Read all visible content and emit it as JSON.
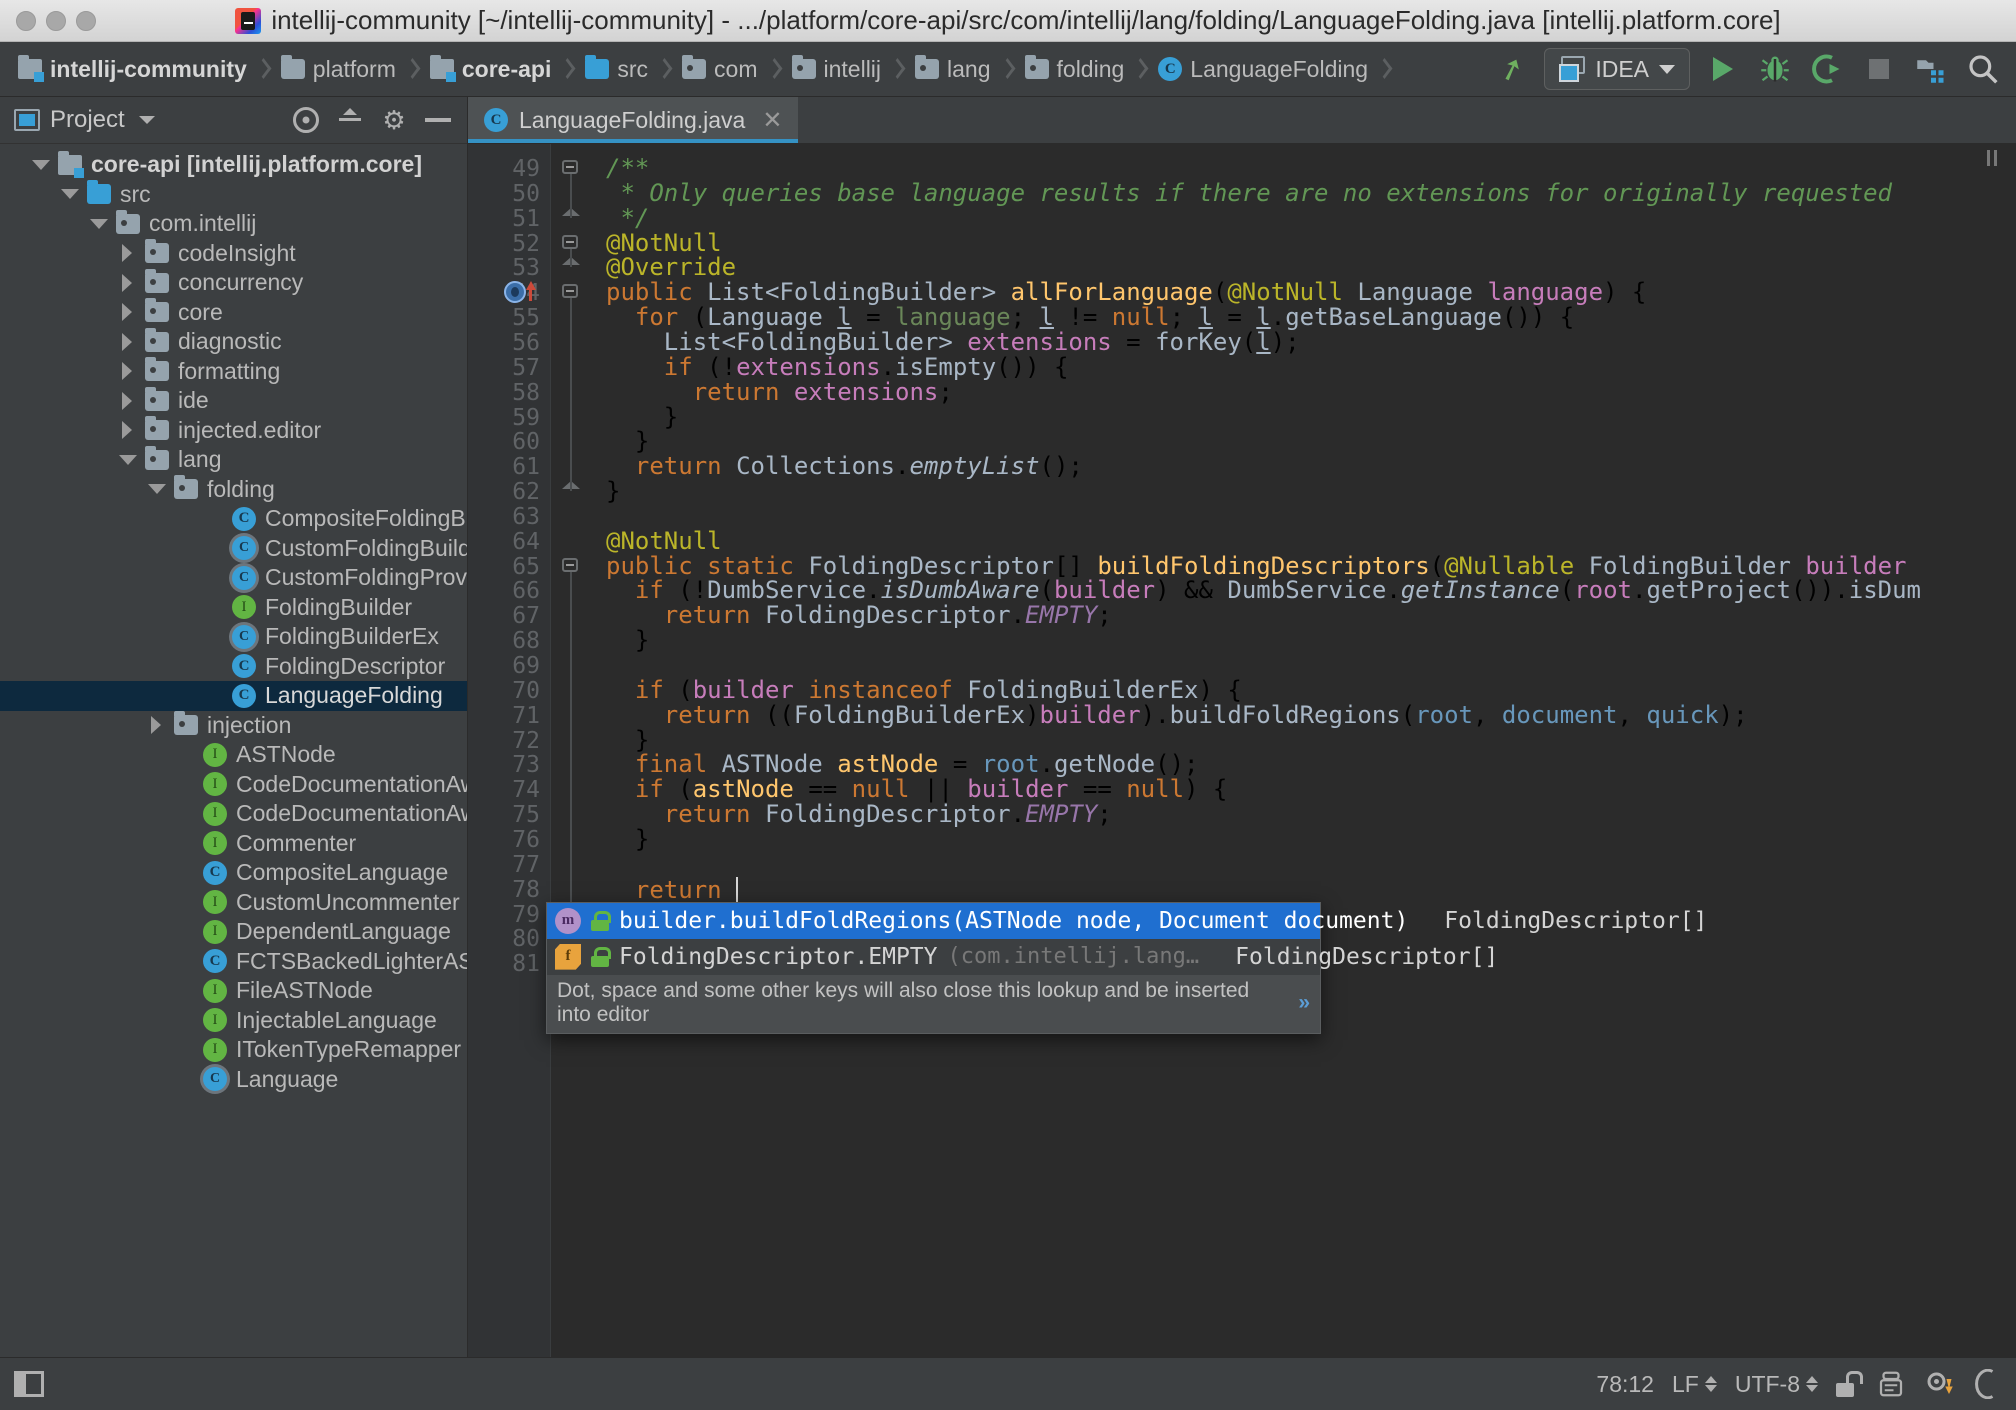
{
  "window": {
    "title": "intellij-community [~/intellij-community] - .../platform/core-api/src/com/intellij/lang/folding/LanguageFolding.java [intellij.platform.core]",
    "logo_icon": "intellij-idea-logo",
    "traffic_lights": [
      "close-button",
      "minimize-button",
      "zoom-button"
    ]
  },
  "navbar": {
    "breadcrumbs": [
      {
        "label": "intellij-community",
        "icon": "module-icon",
        "bold": true
      },
      {
        "label": "platform",
        "icon": "folder-icon",
        "bold": false
      },
      {
        "label": "core-api",
        "icon": "module-icon",
        "bold": true
      },
      {
        "label": "src",
        "icon": "source-folder-icon",
        "bold": false
      },
      {
        "label": "com",
        "icon": "package-icon",
        "bold": false
      },
      {
        "label": "intellij",
        "icon": "package-icon",
        "bold": false
      },
      {
        "label": "lang",
        "icon": "package-icon",
        "bold": false
      },
      {
        "label": "folding",
        "icon": "package-icon",
        "bold": false
      },
      {
        "label": "LanguageFolding",
        "icon": "class-icon",
        "bold": false
      }
    ],
    "actions": {
      "build_label": "Build",
      "run_config_label": "IDEA",
      "run_label": "Run",
      "debug_label": "Debug",
      "run_coverage_label": "Run with Coverage",
      "stop_label": "Stop",
      "project_structure_label": "Project Structure",
      "search_label": "Search Everywhere"
    }
  },
  "sidebar": {
    "title": "Project",
    "toolbar": [
      "locate-icon",
      "collapse-all-icon",
      "settings-icon",
      "hide-icon"
    ],
    "tree": [
      {
        "label": "core-api [intellij.platform.core]",
        "indent": 0,
        "arrow": "open",
        "icon": "module-icon",
        "bold": true,
        "selected": false
      },
      {
        "label": "src",
        "indent": 1,
        "arrow": "open",
        "icon": "source-folder-icon",
        "bold": false,
        "selected": false
      },
      {
        "label": "com.intellij",
        "indent": 2,
        "arrow": "open",
        "icon": "package-icon",
        "bold": false,
        "selected": false
      },
      {
        "label": "codeInsight",
        "indent": 3,
        "arrow": "closed",
        "icon": "package-icon",
        "bold": false,
        "selected": false
      },
      {
        "label": "concurrency",
        "indent": 3,
        "arrow": "closed",
        "icon": "package-icon",
        "bold": false,
        "selected": false
      },
      {
        "label": "core",
        "indent": 3,
        "arrow": "closed",
        "icon": "package-icon",
        "bold": false,
        "selected": false
      },
      {
        "label": "diagnostic",
        "indent": 3,
        "arrow": "closed",
        "icon": "package-icon",
        "bold": false,
        "selected": false
      },
      {
        "label": "formatting",
        "indent": 3,
        "arrow": "closed",
        "icon": "package-icon",
        "bold": false,
        "selected": false
      },
      {
        "label": "ide",
        "indent": 3,
        "arrow": "closed",
        "icon": "package-icon",
        "bold": false,
        "selected": false
      },
      {
        "label": "injected.editor",
        "indent": 3,
        "arrow": "closed",
        "icon": "package-icon",
        "bold": false,
        "selected": false
      },
      {
        "label": "lang",
        "indent": 3,
        "arrow": "open",
        "icon": "package-icon",
        "bold": false,
        "selected": false
      },
      {
        "label": "folding",
        "indent": 4,
        "arrow": "open",
        "icon": "package-icon",
        "bold": false,
        "selected": false
      },
      {
        "label": "CompositeFoldingBuilder",
        "indent": 6,
        "arrow": "none",
        "icon": "class-icon",
        "bold": false,
        "selected": false
      },
      {
        "label": "CustomFoldingBuilder",
        "indent": 6,
        "arrow": "none",
        "icon": "abstract-class-icon",
        "bold": false,
        "selected": false
      },
      {
        "label": "CustomFoldingProvider",
        "indent": 6,
        "arrow": "none",
        "icon": "abstract-class-icon",
        "bold": false,
        "selected": false
      },
      {
        "label": "FoldingBuilder",
        "indent": 6,
        "arrow": "none",
        "icon": "interface-icon",
        "bold": false,
        "selected": false
      },
      {
        "label": "FoldingBuilderEx",
        "indent": 6,
        "arrow": "none",
        "icon": "abstract-class-icon",
        "bold": false,
        "selected": false
      },
      {
        "label": "FoldingDescriptor",
        "indent": 6,
        "arrow": "none",
        "icon": "class-icon",
        "bold": false,
        "selected": false
      },
      {
        "label": "LanguageFolding",
        "indent": 6,
        "arrow": "none",
        "icon": "class-icon",
        "bold": false,
        "selected": true
      },
      {
        "label": "injection",
        "indent": 4,
        "arrow": "closed",
        "icon": "package-icon",
        "bold": false,
        "selected": false
      },
      {
        "label": "ASTNode",
        "indent": 5,
        "arrow": "none",
        "icon": "interface-icon",
        "bold": false,
        "selected": false
      },
      {
        "label": "CodeDocumentationAwareCo",
        "indent": 5,
        "arrow": "none",
        "icon": "interface-icon",
        "bold": false,
        "selected": false
      },
      {
        "label": "CodeDocumentationAwareCo",
        "indent": 5,
        "arrow": "none",
        "icon": "interface-icon",
        "bold": false,
        "selected": false
      },
      {
        "label": "Commenter",
        "indent": 5,
        "arrow": "none",
        "icon": "interface-icon",
        "bold": false,
        "selected": false
      },
      {
        "label": "CompositeLanguage",
        "indent": 5,
        "arrow": "none",
        "icon": "class-icon",
        "bold": false,
        "selected": false
      },
      {
        "label": "CustomUncommenter",
        "indent": 5,
        "arrow": "none",
        "icon": "interface-icon",
        "bold": false,
        "selected": false
      },
      {
        "label": "DependentLanguage",
        "indent": 5,
        "arrow": "none",
        "icon": "interface-icon",
        "bold": false,
        "selected": false
      },
      {
        "label": "FCTSBackedLighterAST",
        "indent": 5,
        "arrow": "none",
        "icon": "class-icon",
        "bold": false,
        "selected": false
      },
      {
        "label": "FileASTNode",
        "indent": 5,
        "arrow": "none",
        "icon": "interface-icon",
        "bold": false,
        "selected": false
      },
      {
        "label": "InjectableLanguage",
        "indent": 5,
        "arrow": "none",
        "icon": "interface-icon",
        "bold": false,
        "selected": false
      },
      {
        "label": "ITokenTypeRemapper",
        "indent": 5,
        "arrow": "none",
        "icon": "interface-icon",
        "bold": false,
        "selected": false
      },
      {
        "label": "Language",
        "indent": 5,
        "arrow": "none",
        "icon": "abstract-class-icon",
        "bold": false,
        "selected": false
      }
    ]
  },
  "editor": {
    "tab": {
      "label": "LanguageFolding.java",
      "icon": "class-icon",
      "close_icon": "close-icon"
    },
    "first_line_number": 49,
    "lines": [
      {
        "n": 49,
        "html": "<span class=\"cmt\">/**</span>"
      },
      {
        "n": 50,
        "html": "<span class=\"cmt\"> * Only queries base language results if there are no extensions for originally requested</span>"
      },
      {
        "n": 51,
        "html": "<span class=\"cmt\"> */</span>"
      },
      {
        "n": 52,
        "html": "<span class=\"ann\">@NotNull</span>"
      },
      {
        "n": 53,
        "html": "<span class=\"ann\">@Override</span>"
      },
      {
        "n": 54,
        "html": "<span class=\"kw\">public</span> <span class=\"id\">List&lt;FoldingBuilder&gt;</span> <span class=\"mth\">allForLanguage</span>(<span class=\"ann\">@NotNull</span> <span class=\"id\">Language</span> <span class=\"par\">language</span>) {"
      },
      {
        "n": 55,
        "html": "  <span class=\"kw\">for</span> (<span class=\"id\">Language</span> <span class=\"id undl\">l</span> = <span class=\"grn\">language</span>; <span class=\"id undl\">l</span> != <span class=\"kw\">null</span>; <span class=\"id undl\">l</span> = <span class=\"id undl\">l</span>.<span class=\"id\">getBaseLanguage</span>()) {"
      },
      {
        "n": 56,
        "html": "    <span class=\"id\">List&lt;FoldingBuilder&gt;</span> <span class=\"par\">extensions</span> = <span class=\"id\">forKey</span>(<span class=\"id undl\">l</span>);"
      },
      {
        "n": 57,
        "html": "    <span class=\"kw\">if</span> (!<span class=\"par\">extensions</span>.<span class=\"id\">isEmpty</span>()) {"
      },
      {
        "n": 58,
        "html": "      <span class=\"kw\">return</span> <span class=\"par\">extensions</span>;"
      },
      {
        "n": 59,
        "html": "    }"
      },
      {
        "n": 60,
        "html": "  }"
      },
      {
        "n": 61,
        "html": "  <span class=\"kw\">return</span> <span class=\"id\">Collections</span>.<span class=\"id ital\">emptyList</span>();"
      },
      {
        "n": 62,
        "html": "}"
      },
      {
        "n": 63,
        "html": ""
      },
      {
        "n": 64,
        "html": "<span class=\"ann\">@NotNull</span>"
      },
      {
        "n": 65,
        "html": "<span class=\"kw\">public</span> <span class=\"kw\">static</span> <span class=\"id\">FoldingDescriptor</span>[] <span class=\"mth\">buildFoldingDescriptors</span>(<span class=\"ann\">@Nullable</span> <span class=\"id\">FoldingBuilder</span> <span class=\"par\">builder</span>"
      },
      {
        "n": 66,
        "html": "  <span class=\"kw\">if</span> (!<span class=\"id\">DumbService</span>.<span class=\"id ital\">isDumbAware</span>(<span class=\"par\">builder</span>) &amp;&amp; <span class=\"id\">DumbService</span>.<span class=\"id ital\">getInstance</span>(<span class=\"par\">root</span>.<span class=\"id\">getProject</span>()).<span class=\"id\">isDum</span>"
      },
      {
        "n": 67,
        "html": "    <span class=\"kw\">return</span> <span class=\"id\">FoldingDescriptor</span>.<span class=\"fld ital\">EMPTY</span>;"
      },
      {
        "n": 68,
        "html": "  }"
      },
      {
        "n": 69,
        "html": ""
      },
      {
        "n": 70,
        "html": "  <span class=\"kw\">if</span> (<span class=\"par\">builder</span> <span class=\"kw\">instanceof</span> <span class=\"id\">FoldingBuilderEx</span>) {"
      },
      {
        "n": 71,
        "html": "    <span class=\"kw\">return</span> ((<span class=\"id\">FoldingBuilderEx</span>)<span class=\"par\">builder</span>).<span class=\"id\">buildFoldRegions</span>(<span class=\"blu\">root</span>, <span class=\"blu\">document</span>, <span class=\"blu\">quick</span>);"
      },
      {
        "n": 72,
        "html": "  }"
      },
      {
        "n": 73,
        "html": "  <span class=\"kw\">final</span> <span class=\"id\">ASTNode</span> <span class=\"mth\">astNode</span> = <span class=\"blu\">root</span>.<span class=\"id\">getNode</span>();"
      },
      {
        "n": 74,
        "html": "  <span class=\"kw\">if</span> (<span class=\"mth\">astNode</span> == <span class=\"kw\">null</span> || <span class=\"par\">builder</span> == <span class=\"kw\">null</span>) {"
      },
      {
        "n": 75,
        "html": "    <span class=\"kw\">return</span> <span class=\"id\">FoldingDescriptor</span>.<span class=\"fld ital\">EMPTY</span>;"
      },
      {
        "n": 76,
        "html": "  }"
      },
      {
        "n": 77,
        "html": ""
      },
      {
        "n": 78,
        "html": "  <span class=\"kw\">return</span> <span class=\"caret\"></span>"
      },
      {
        "n": 79,
        "html": "}"
      },
      {
        "n": 80,
        "html": "}"
      },
      {
        "n": 81,
        "html": ""
      }
    ]
  },
  "lookup": {
    "items": [
      {
        "text": "builder.buildFoldRegions(ASTNode node, Document document)",
        "dim": "",
        "type": "FoldingDescriptor[]",
        "icon": "method-icon",
        "visibility_icon": "public-lock-icon",
        "selected": true
      },
      {
        "text": "FoldingDescriptor.EMPTY",
        "dim": "(com.intellij.lang…",
        "type": "FoldingDescriptor[]",
        "icon": "field-icon",
        "visibility_icon": "public-lock-icon",
        "selected": false
      }
    ],
    "hint": "Dot, space and some other keys will also close this lookup and be inserted into editor",
    "hint_arrow": "»"
  },
  "statusbar": {
    "toggle_icon": "toggle-sidebar-icon",
    "caret_position": "78:12",
    "line_separator": "LF",
    "encoding": "UTF-8",
    "lock_icon": "unlocked-icon",
    "inspector_icon": "inspection-icon",
    "background_task_icon": "background-tasks-icon",
    "memory_icon": "memory-indicator-icon"
  },
  "colors": {
    "accent": "#3592c4",
    "selection": "#0d293e",
    "lookup_selection": "#1f6fd0",
    "editor_bg": "#2b2b2b",
    "panel_bg": "#3c3f41",
    "keyword": "#cc7832",
    "comment": "#629755",
    "annotation": "#bbb529",
    "method": "#ffc66d",
    "field": "#9876aa",
    "number": "#6897bb",
    "parameter": "#c77dbb",
    "identifier": "#a9b7c6"
  }
}
